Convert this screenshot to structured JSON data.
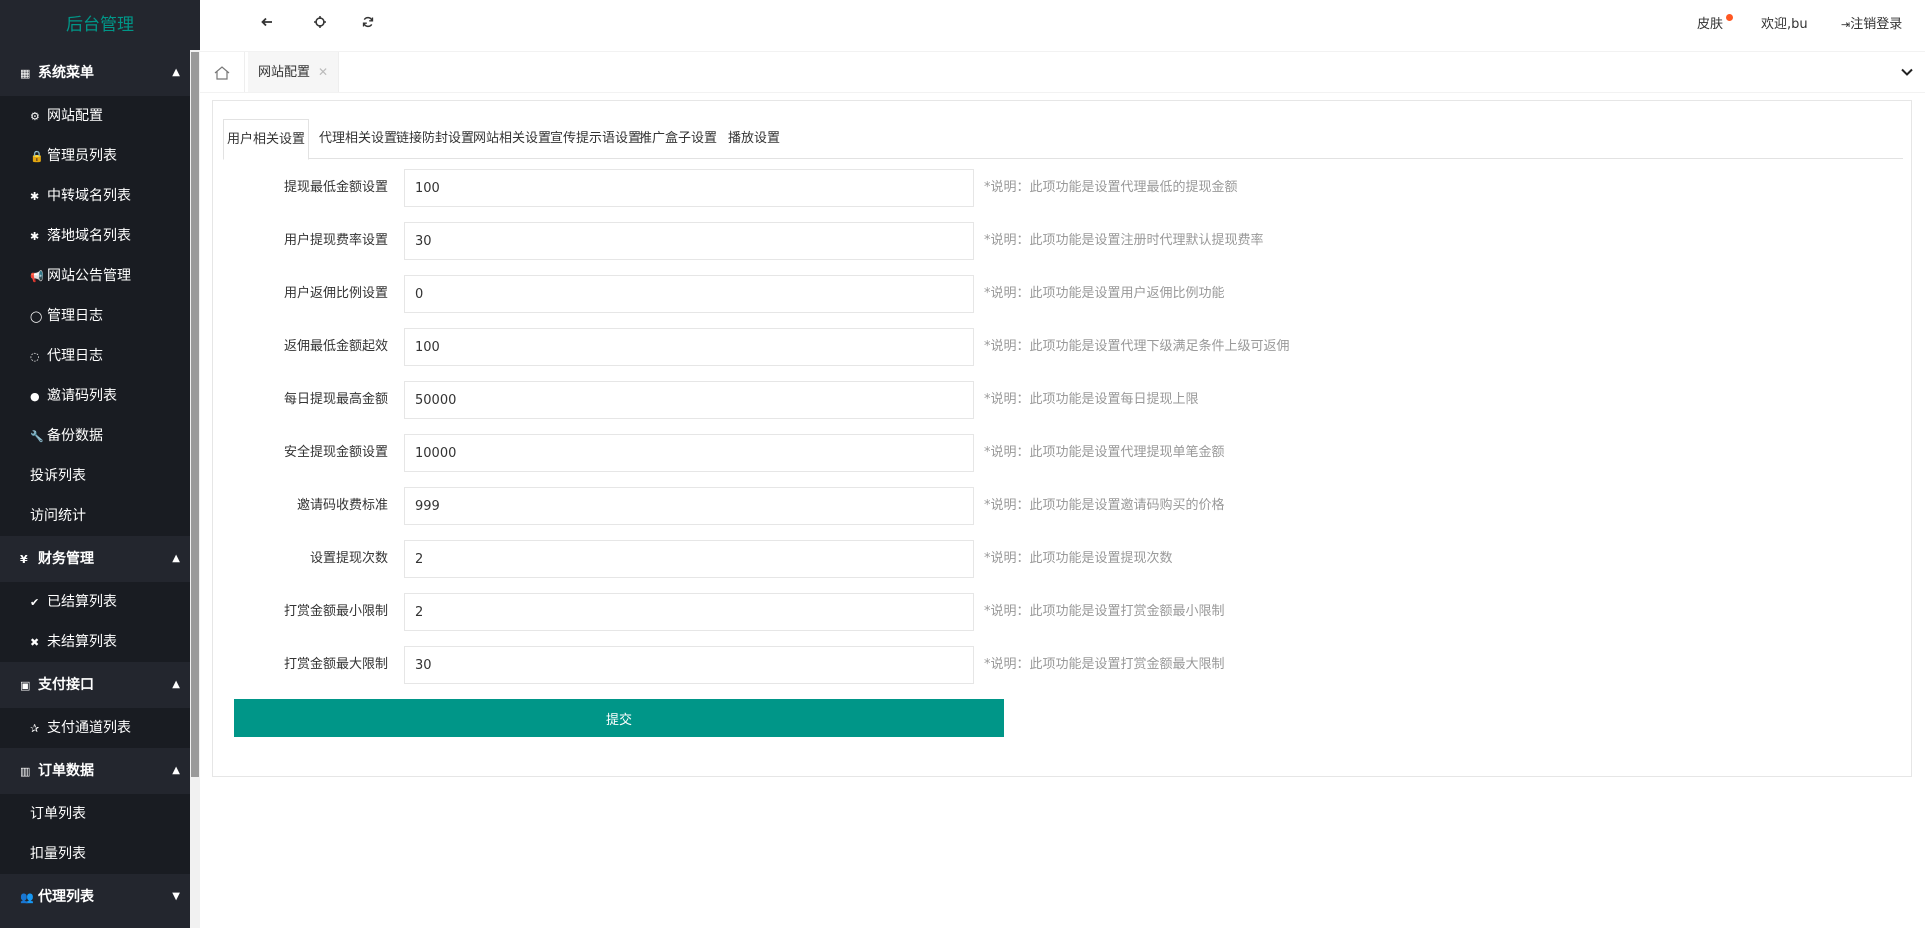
{
  "app": {
    "logo": "后台管理"
  },
  "topbar": {
    "skin_label": "皮肤",
    "welcome": "欢迎,bu",
    "logout_label": "注销登录"
  },
  "tabs": {
    "current": "网站配置",
    "close": "✕"
  },
  "sidebar": {
    "groups": [
      {
        "title": "系统菜单",
        "icon": "grid-icon",
        "expanded": true,
        "items": [
          {
            "label": "网站配置",
            "icon": "cogs-icon"
          },
          {
            "label": "管理员列表",
            "icon": "lock-icon"
          },
          {
            "label": "中转域名列表",
            "icon": "gear-icon"
          },
          {
            "label": "落地域名列表",
            "icon": "gear-icon"
          },
          {
            "label": "网站公告管理",
            "icon": "bullhorn-icon"
          },
          {
            "label": "管理日志",
            "icon": "comment-icon"
          },
          {
            "label": "代理日志",
            "icon": "comments-icon"
          },
          {
            "label": "邀请码列表",
            "icon": "circle-icon"
          },
          {
            "label": "备份数据",
            "icon": "wrench-icon"
          },
          {
            "label": "投诉列表",
            "icon": ""
          },
          {
            "label": "访问统计",
            "icon": ""
          }
        ]
      },
      {
        "title": "财务管理",
        "icon": "yen-icon",
        "expanded": true,
        "items": [
          {
            "label": "已结算列表",
            "icon": "check-icon"
          },
          {
            "label": "未结算列表",
            "icon": "times-icon"
          }
        ]
      },
      {
        "title": "支付接口",
        "icon": "payment-icon",
        "expanded": true,
        "items": [
          {
            "label": "支付通道列表",
            "icon": "star-icon"
          }
        ]
      },
      {
        "title": "订单数据",
        "icon": "bar-chart-icon",
        "expanded": true,
        "items": [
          {
            "label": "订单列表",
            "icon": ""
          },
          {
            "label": "扣量列表",
            "icon": ""
          }
        ]
      },
      {
        "title": "代理列表",
        "icon": "users-icon",
        "expanded": false,
        "items": []
      }
    ]
  },
  "settings_tabs": [
    "用户相关设置",
    "代理相关设置",
    "链接防封设置",
    "网站相关设置",
    "宣传提示语设置",
    "推广盒子设置",
    "播放设置"
  ],
  "form": {
    "fields": [
      {
        "label": "提现最低金额设置",
        "value": "100",
        "tip": "*说明：此项功能是设置代理最低的提现金额"
      },
      {
        "label": "用户提现费率设置",
        "value": "30",
        "tip": "*说明：此项功能是设置注册时代理默认提现费率"
      },
      {
        "label": "用户返佣比例设置",
        "value": "0",
        "tip": "*说明：此项功能是设置用户返佣比例功能"
      },
      {
        "label": "返佣最低金额起效",
        "value": "100",
        "tip": "*说明：此项功能是设置代理下级满足条件上级可返佣"
      },
      {
        "label": "每日提现最高金额",
        "value": "50000",
        "tip": "*说明：此项功能是设置每日提现上限"
      },
      {
        "label": "安全提现金额设置",
        "value": "10000",
        "tip": "*说明：此项功能是设置代理提现单笔金额"
      },
      {
        "label": "邀请码收费标准",
        "value": "999",
        "tip": "*说明：此项功能是设置邀请码购买的价格"
      },
      {
        "label": "设置提现次数",
        "value": "2",
        "tip": "*说明：此项功能是设置提现次数"
      },
      {
        "label": "打赏金额最小限制",
        "value": "2",
        "tip": "*说明：此项功能是设置打赏金额最小限制"
      },
      {
        "label": "打赏金额最大限制",
        "value": "30",
        "tip": "*说明：此项功能是设置打赏金额最大限制"
      }
    ],
    "submit_label": "提交"
  },
  "colors": {
    "accent": "#009688",
    "sidebar_bg": "#23262e",
    "sidebar_item_bg": "#191c22",
    "badge": "#ff5722"
  }
}
